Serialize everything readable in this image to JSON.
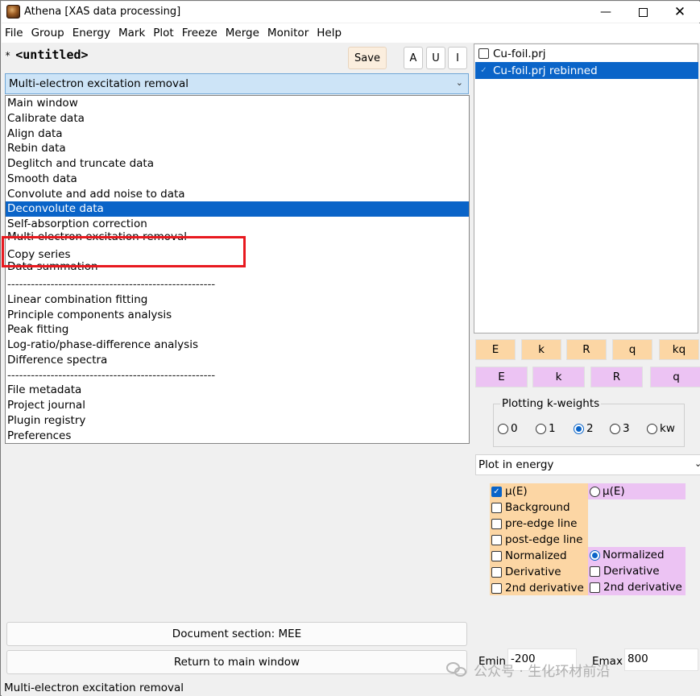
{
  "window": {
    "title": "Athena [XAS data processing]",
    "min_glyph": "—",
    "close_glyph": "✕"
  },
  "menubar": {
    "items": [
      "File",
      "Group",
      "Energy",
      "Mark",
      "Plot",
      "Freeze",
      "Merge",
      "Monitor",
      "Help"
    ]
  },
  "project": {
    "modified_marker": "*",
    "name": "<untitled>"
  },
  "toolbar": {
    "save_label": "Save",
    "a_label": "A",
    "u_label": "U",
    "i_label": "I"
  },
  "tool_selector": {
    "selected": "Multi-electron excitation removal",
    "arrow": "⌄",
    "items": [
      "Main window",
      "Calibrate data",
      "Align data",
      "Rebin data",
      "Deglitch and truncate data",
      "Smooth data",
      "Convolute and add noise to data",
      "Deconvolute data",
      "Self-absorption correction",
      "Multi-electron excitation removal",
      "Copy series",
      "Data summation",
      "-----------------------------------------------------",
      "Linear combination fitting",
      "Principle components analysis",
      "Peak fitting",
      "Log-ratio/phase-difference analysis",
      "Difference spectra",
      "-----------------------------------------------------",
      "File metadata",
      "Project journal",
      "Plugin registry",
      "Preferences"
    ],
    "highlighted_item": "Deconvolute data",
    "annotated_item": "Copy series"
  },
  "bottom_buttons": {
    "document_section": "Document section: MEE",
    "return_main": "Return to main window"
  },
  "status_bar": {
    "text": "Multi-electron excitation removal"
  },
  "groups": {
    "items": [
      {
        "label": "Cu-foil.prj",
        "checked": false,
        "selected": false
      },
      {
        "label": "Cu-foil.prj rebinned",
        "checked": true,
        "selected": true
      }
    ]
  },
  "plot_buttons": {
    "single": [
      "E",
      "k",
      "R",
      "q",
      "kq"
    ],
    "marked": [
      "E",
      "k",
      "R",
      "q"
    ]
  },
  "kweights": {
    "legend": "Plotting k-weights",
    "options": [
      "0",
      "1",
      "2",
      "3",
      "kw"
    ],
    "selected": "2"
  },
  "plot_space": {
    "selected": "Plot in energy",
    "arrow": "⌄"
  },
  "energy_options": {
    "single": [
      {
        "label": "μ(E)",
        "checked": true
      },
      {
        "label": "Background",
        "checked": false
      },
      {
        "label": "pre-edge line",
        "checked": false
      },
      {
        "label": "post-edge line",
        "checked": false
      },
      {
        "label": "Normalized",
        "checked": false
      },
      {
        "label": "Derivative",
        "checked": false
      },
      {
        "label": "2nd derivative",
        "checked": false
      }
    ],
    "marked": {
      "mu_label": "μ(E)",
      "normalized_label": "Normalized",
      "derivative_label": "Derivative",
      "second_derivative_label": "2nd derivative"
    }
  },
  "energy_range": {
    "emin_label": "Emin",
    "emin_value": "-200",
    "emax_label": "Emax",
    "emax_value": "800"
  },
  "watermark": {
    "text": "公众号 · 生化环材前沿"
  },
  "colors": {
    "selection_blue": "#0a64c8",
    "orange_panel": "#fcd6a4",
    "violet_panel": "#ecc3f3",
    "annotation_red": "#e8191f"
  }
}
